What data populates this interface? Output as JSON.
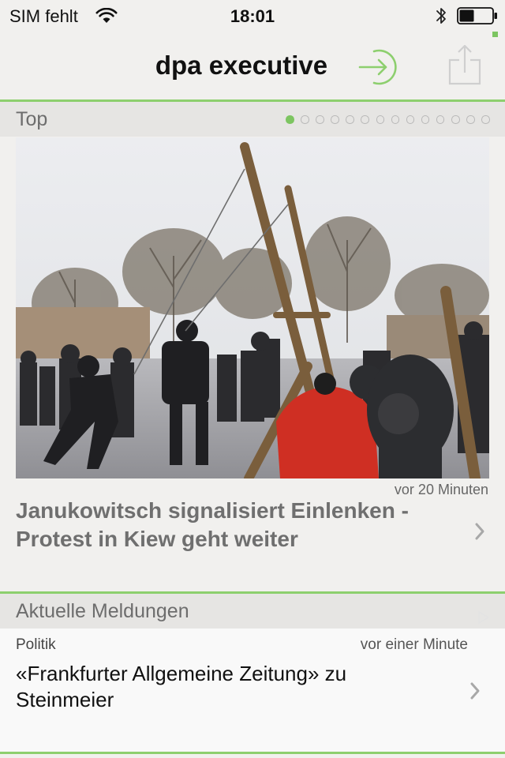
{
  "status_bar": {
    "carrier": "SIM fehlt",
    "time": "18:01",
    "battery_level": 0.45,
    "wifi_icon": "wifi-icon",
    "bluetooth_icon": "bluetooth-icon"
  },
  "nav": {
    "title": "dpa executive",
    "login_icon": "login-arrow-icon",
    "share_icon": "share-icon"
  },
  "top_section": {
    "title": "Top",
    "pager": {
      "total": 14,
      "active_index": 0
    },
    "story": {
      "image": "photo-protesters-with-giant-slingshot",
      "time": "vor 20 Minuten",
      "headline": "Janukowitsch signalisiert Einlenken - Protest in Kiew geht weiter"
    }
  },
  "news_section": {
    "title": "Aktuelle Meldungen",
    "items": [
      {
        "category": "Politik",
        "time": "vor einer Minute",
        "headline": "«Frankfurter Allgemeine Zeitung» zu Steinmeier"
      }
    ]
  },
  "colors": {
    "accent_green": "#7dc561",
    "rule_green": "#8dcf6e",
    "background": "#f1f0ee",
    "section_header_bg": "#e6e5e3",
    "muted_text": "#6f6f6f"
  }
}
